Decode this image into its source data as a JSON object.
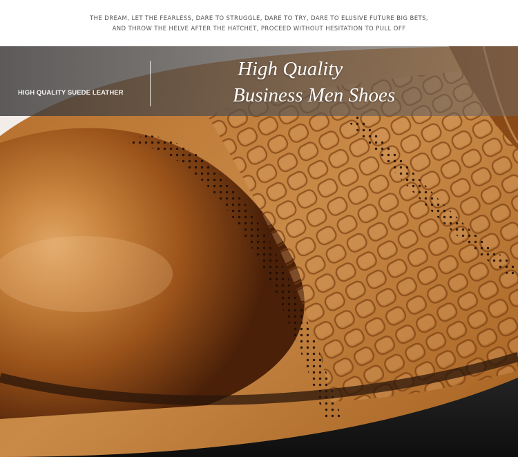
{
  "motto": {
    "line1": "THE DREAM, LET THE FEARLESS, DARE TO STRUGGLE, DARE TO TRY, DARE TO ELUSIVE FUTURE BIG BETS,",
    "line2": "AND THROW THE HELVE AFTER THE HATCHET, PROCEED WITHOUT HESITATION TO PULL OFF"
  },
  "banner": {
    "caption": "HIGH QUALITY SUEDE LEATHER",
    "title_line1": "High Quality",
    "title_line2": "Business Men Shoes"
  },
  "colors": {
    "leather_light": "#c98a48",
    "leather_mid": "#a8611f",
    "leather_dark": "#5e2e0d",
    "sole": "#1a1a1a"
  }
}
